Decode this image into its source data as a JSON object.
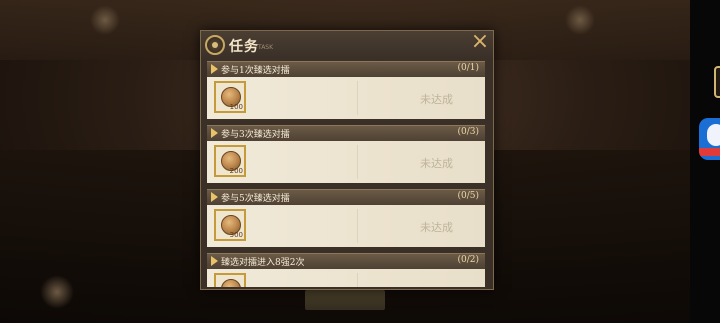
{
  "panel": {
    "title": "任务",
    "subtitle": "TASK",
    "close_icon": "×"
  },
  "tasks": [
    {
      "name": "参与1次臻选对擂",
      "progress": "(0/1)",
      "reward_amount": "100",
      "status": "未达成"
    },
    {
      "name": "参与3次臻选对擂",
      "progress": "(0/3)",
      "reward_amount": "200",
      "status": "未达成"
    },
    {
      "name": "参与5次臻选对擂",
      "progress": "(0/5)",
      "reward_amount": "300",
      "status": "未达成"
    },
    {
      "name": "臻选对擂进入8强2次",
      "progress": "(0/2)",
      "reward_amount": "",
      "status": ""
    }
  ]
}
